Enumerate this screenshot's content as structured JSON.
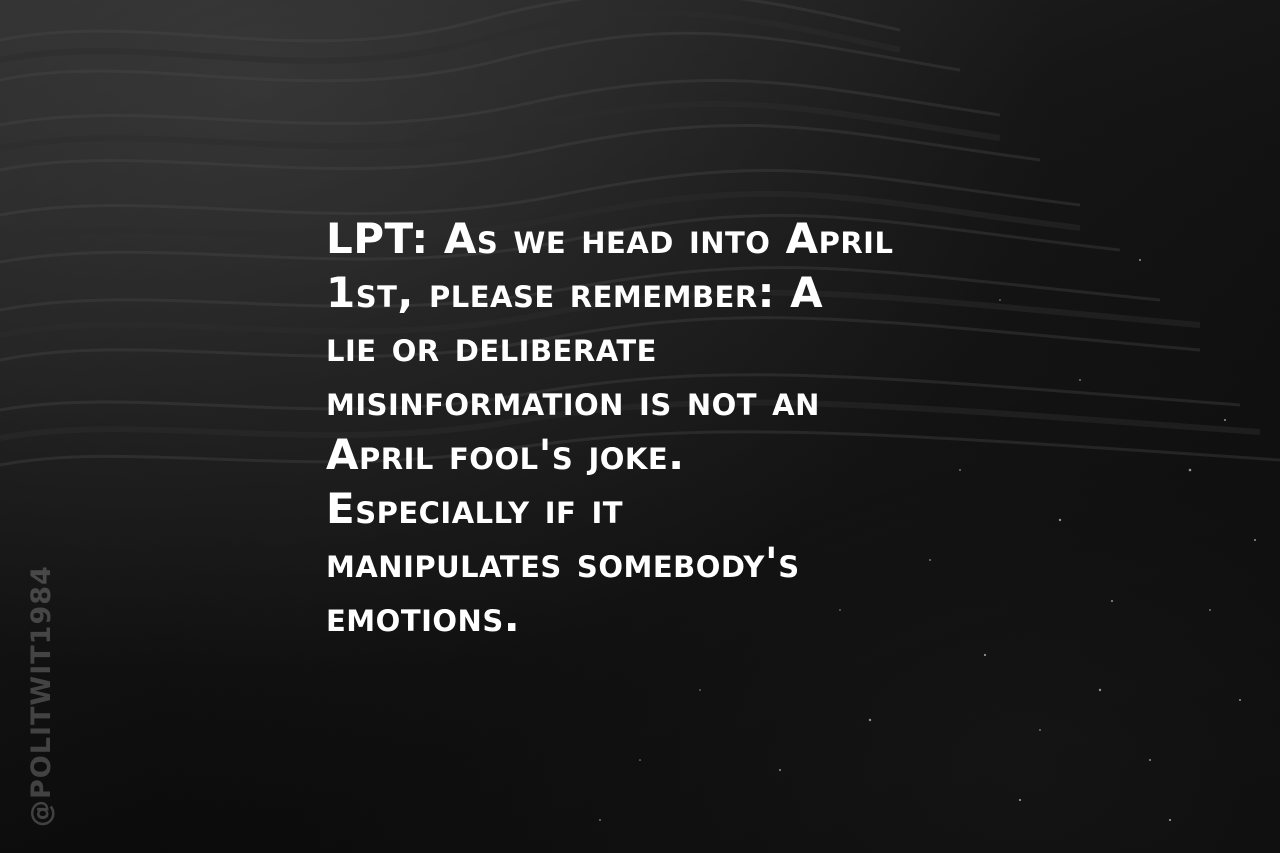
{
  "quote": {
    "lines": [
      "LPT: As we head into April",
      "1st, please remember: A",
      "lie or deliberate",
      "misinformation is not an",
      "April fool's joke.",
      "Especially if it",
      "manipulates somebody's",
      "emotions."
    ]
  },
  "watermark": {
    "handle": "@POLITWIT1984"
  },
  "colors": {
    "text": "#ffffff",
    "background": "#111111",
    "watermark": "#c8c8c8"
  }
}
